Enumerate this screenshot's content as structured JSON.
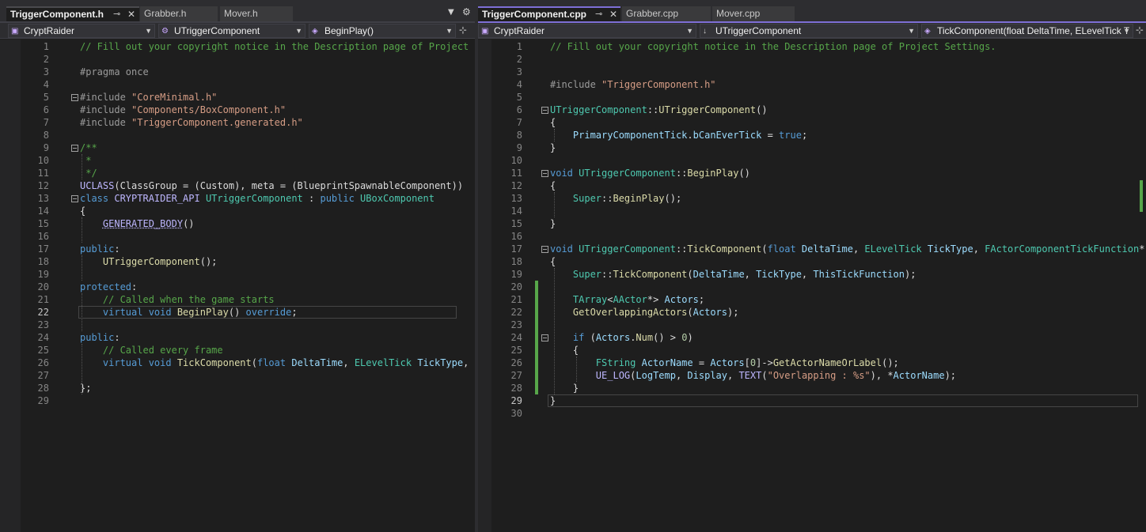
{
  "left": {
    "tabs": [
      {
        "label": "TriggerComponent.h",
        "active": true
      },
      {
        "label": "Grabber.h",
        "active": false
      },
      {
        "label": "Mover.h",
        "active": false
      }
    ],
    "nav": {
      "project": "CryptRaider",
      "scope": "UTriggerComponent",
      "member": "BeginPlay()"
    },
    "current_line": "22",
    "lines": [
      {
        "n": "1",
        "t": [
          [
            "// Fill out your copyright notice in the Description page of Project",
            "c"
          ]
        ]
      },
      {
        "n": "2",
        "t": []
      },
      {
        "n": "3",
        "t": [
          [
            "#pragma once",
            "d"
          ]
        ]
      },
      {
        "n": "4",
        "t": []
      },
      {
        "n": "5",
        "t": [
          [
            "#include ",
            "d"
          ],
          [
            "\"CoreMinimal.h\"",
            "s"
          ]
        ]
      },
      {
        "n": "6",
        "t": [
          [
            "#include ",
            "d"
          ],
          [
            "\"Components/BoxComponent.h\"",
            "s"
          ]
        ]
      },
      {
        "n": "7",
        "t": [
          [
            "#include ",
            "d"
          ],
          [
            "\"TriggerComponent.generated.h\"",
            "s"
          ]
        ]
      },
      {
        "n": "8",
        "t": []
      },
      {
        "n": "9",
        "t": [
          [
            "/**",
            "c"
          ]
        ]
      },
      {
        "n": "10",
        "t": [
          [
            " *",
            "c"
          ]
        ]
      },
      {
        "n": "11",
        "t": [
          [
            " */",
            "c"
          ]
        ]
      },
      {
        "n": "12",
        "t": [
          [
            "UCLASS",
            "m"
          ],
          [
            "(ClassGroup = (Custom), meta = (BlueprintSpawnableComponent))",
            ""
          ]
        ]
      },
      {
        "n": "13",
        "t": [
          [
            "class ",
            "k"
          ],
          [
            "CRYPTRAIDER_API ",
            "m"
          ],
          [
            "UTriggerComponent",
            "t"
          ],
          [
            " : ",
            ""
          ],
          [
            "public ",
            "k"
          ],
          [
            "UBoxComponent",
            "t"
          ]
        ]
      },
      {
        "n": "14",
        "t": [
          [
            "{",
            ""
          ]
        ]
      },
      {
        "n": "15",
        "t": [
          [
            "    ",
            ""
          ],
          [
            "GENERATED_BODY",
            "mu"
          ],
          [
            "()",
            ""
          ]
        ]
      },
      {
        "n": "16",
        "t": []
      },
      {
        "n": "17",
        "t": [
          [
            "public",
            "k"
          ],
          [
            ":",
            ""
          ]
        ]
      },
      {
        "n": "18",
        "t": [
          [
            "    ",
            ""
          ],
          [
            "UTriggerComponent",
            "f"
          ],
          [
            "();",
            ""
          ]
        ]
      },
      {
        "n": "19",
        "t": []
      },
      {
        "n": "20",
        "t": [
          [
            "protected",
            "k"
          ],
          [
            ":",
            ""
          ]
        ]
      },
      {
        "n": "21",
        "t": [
          [
            "    // Called when the game starts",
            "c"
          ]
        ]
      },
      {
        "n": "22",
        "t": [
          [
            "    ",
            ""
          ],
          [
            "virtual ",
            "k"
          ],
          [
            "void ",
            "k"
          ],
          [
            "BeginPlay",
            "f"
          ],
          [
            "() ",
            ""
          ],
          [
            "override",
            "k"
          ],
          [
            ";",
            ""
          ]
        ]
      },
      {
        "n": "23",
        "t": []
      },
      {
        "n": "24",
        "t": [
          [
            "public",
            "k"
          ],
          [
            ":",
            ""
          ]
        ]
      },
      {
        "n": "25",
        "t": [
          [
            "    // Called every frame",
            "c"
          ]
        ]
      },
      {
        "n": "26",
        "t": [
          [
            "    ",
            ""
          ],
          [
            "virtual ",
            "k"
          ],
          [
            "void ",
            "k"
          ],
          [
            "TickComponent",
            "f"
          ],
          [
            "(",
            ""
          ],
          [
            "float ",
            "k"
          ],
          [
            "DeltaTime",
            "v"
          ],
          [
            ", ",
            ""
          ],
          [
            "ELevelTick ",
            "t"
          ],
          [
            "TickType",
            "v"
          ],
          [
            ",",
            ""
          ]
        ]
      },
      {
        "n": "27",
        "t": []
      },
      {
        "n": "28",
        "t": [
          [
            "};",
            ""
          ]
        ]
      },
      {
        "n": "29",
        "t": []
      }
    ]
  },
  "right": {
    "tabs": [
      {
        "label": "TriggerComponent.cpp",
        "active": true
      },
      {
        "label": "Grabber.cpp",
        "active": false
      },
      {
        "label": "Mover.cpp",
        "active": false
      }
    ],
    "nav": {
      "project": "CryptRaider",
      "scope": "UTriggerComponent",
      "member": "TickComponent(float DeltaTime, ELevelTick T"
    },
    "current_line": "29",
    "lines": [
      {
        "n": "1",
        "t": [
          [
            "// Fill out your copyright notice in the Description page of Project Settings.",
            "c"
          ]
        ]
      },
      {
        "n": "2",
        "t": []
      },
      {
        "n": "3",
        "t": []
      },
      {
        "n": "4",
        "t": [
          [
            "#include ",
            "d"
          ],
          [
            "\"TriggerComponent.h\"",
            "s"
          ]
        ]
      },
      {
        "n": "5",
        "t": []
      },
      {
        "n": "6",
        "t": [
          [
            "UTriggerComponent",
            "t"
          ],
          [
            "::",
            ""
          ],
          [
            "UTriggerComponent",
            "f"
          ],
          [
            "()",
            ""
          ]
        ]
      },
      {
        "n": "7",
        "t": [
          [
            "{",
            ""
          ]
        ]
      },
      {
        "n": "8",
        "t": [
          [
            "    ",
            ""
          ],
          [
            "PrimaryComponentTick",
            "v"
          ],
          [
            ".",
            ""
          ],
          [
            "bCanEverTick",
            "v"
          ],
          [
            " = ",
            ""
          ],
          [
            "true",
            "k"
          ],
          [
            ";",
            ""
          ]
        ]
      },
      {
        "n": "9",
        "t": [
          [
            "}",
            ""
          ]
        ]
      },
      {
        "n": "10",
        "t": []
      },
      {
        "n": "11",
        "t": [
          [
            "void ",
            "k"
          ],
          [
            "UTriggerComponent",
            "t"
          ],
          [
            "::",
            ""
          ],
          [
            "BeginPlay",
            "f"
          ],
          [
            "()",
            ""
          ]
        ]
      },
      {
        "n": "12",
        "t": [
          [
            "{",
            ""
          ]
        ]
      },
      {
        "n": "13",
        "t": [
          [
            "    ",
            ""
          ],
          [
            "Super",
            "t"
          ],
          [
            "::",
            ""
          ],
          [
            "BeginPlay",
            "f"
          ],
          [
            "();",
            ""
          ]
        ]
      },
      {
        "n": "14",
        "t": []
      },
      {
        "n": "15",
        "t": [
          [
            "}",
            ""
          ]
        ]
      },
      {
        "n": "16",
        "t": []
      },
      {
        "n": "17",
        "t": [
          [
            "void ",
            "k"
          ],
          [
            "UTriggerComponent",
            "t"
          ],
          [
            "::",
            ""
          ],
          [
            "TickComponent",
            "f"
          ],
          [
            "(",
            ""
          ],
          [
            "float ",
            "k"
          ],
          [
            "DeltaTime",
            "v"
          ],
          [
            ", ",
            ""
          ],
          [
            "ELevelTick ",
            "t"
          ],
          [
            "TickType",
            "v"
          ],
          [
            ", ",
            ""
          ],
          [
            "FActorComponentTickFunction",
            "t"
          ],
          [
            "* ",
            ""
          ],
          [
            "Th",
            "v"
          ]
        ]
      },
      {
        "n": "18",
        "t": [
          [
            "{",
            ""
          ]
        ]
      },
      {
        "n": "19",
        "t": [
          [
            "    ",
            ""
          ],
          [
            "Super",
            "t"
          ],
          [
            "::",
            ""
          ],
          [
            "TickComponent",
            "f"
          ],
          [
            "(",
            ""
          ],
          [
            "DeltaTime",
            "v"
          ],
          [
            ", ",
            ""
          ],
          [
            "TickType",
            "v"
          ],
          [
            ", ",
            ""
          ],
          [
            "ThisTickFunction",
            "v"
          ],
          [
            ");",
            ""
          ]
        ]
      },
      {
        "n": "20",
        "t": []
      },
      {
        "n": "21",
        "t": [
          [
            "    ",
            ""
          ],
          [
            "TArray",
            "t"
          ],
          [
            "<",
            ""
          ],
          [
            "AActor",
            "t"
          ],
          [
            "*> ",
            ""
          ],
          [
            "Actors",
            "v"
          ],
          [
            ";",
            ""
          ]
        ]
      },
      {
        "n": "22",
        "t": [
          [
            "    ",
            ""
          ],
          [
            "GetOverlappingActors",
            "f"
          ],
          [
            "(",
            ""
          ],
          [
            "Actors",
            "v"
          ],
          [
            ");",
            ""
          ]
        ]
      },
      {
        "n": "23",
        "t": []
      },
      {
        "n": "24",
        "t": [
          [
            "    ",
            ""
          ],
          [
            "if ",
            "k"
          ],
          [
            "(",
            ""
          ],
          [
            "Actors",
            "v"
          ],
          [
            ".",
            ""
          ],
          [
            "Num",
            "f"
          ],
          [
            "() > ",
            ""
          ],
          [
            "0",
            "n"
          ],
          [
            ")",
            ""
          ]
        ]
      },
      {
        "n": "25",
        "t": [
          [
            "    {",
            ""
          ]
        ]
      },
      {
        "n": "26",
        "t": [
          [
            "        ",
            ""
          ],
          [
            "FString ",
            "t"
          ],
          [
            "ActorName",
            "v"
          ],
          [
            " = ",
            ""
          ],
          [
            "Actors",
            "v"
          ],
          [
            "[",
            ""
          ],
          [
            "0",
            "n"
          ],
          [
            "]->",
            ""
          ],
          [
            "GetActorNameOrLabel",
            "f"
          ],
          [
            "();",
            ""
          ]
        ]
      },
      {
        "n": "27",
        "t": [
          [
            "        ",
            ""
          ],
          [
            "UE_LOG",
            "m"
          ],
          [
            "(",
            ""
          ],
          [
            "LogTemp",
            "v"
          ],
          [
            ", ",
            ""
          ],
          [
            "Display",
            "v"
          ],
          [
            ", ",
            ""
          ],
          [
            "TEXT",
            "m"
          ],
          [
            "(",
            ""
          ],
          [
            "\"Overlapping : %s\"",
            "s"
          ],
          [
            "), *",
            ""
          ],
          [
            "ActorName",
            "v"
          ],
          [
            ");",
            ""
          ]
        ]
      },
      {
        "n": "28",
        "t": [
          [
            "    }",
            ""
          ]
        ]
      },
      {
        "n": "29",
        "t": [
          [
            "}",
            ""
          ]
        ]
      },
      {
        "n": "30",
        "t": []
      }
    ]
  },
  "icons": {
    "pin": "pin-icon",
    "close": "close-icon",
    "dropdown": "chevron-down-icon",
    "settings": "gear-icon",
    "split": "split-window-icon"
  }
}
